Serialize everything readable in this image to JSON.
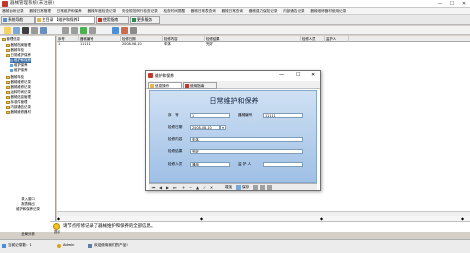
{
  "window": {
    "title": "器械管理系统(未注册)",
    "min": "—",
    "max": "☐",
    "close": "✕"
  },
  "menu": [
    "器械台帐记录",
    "器械日常管理",
    "日常维护和保养",
    "器械年度检查记录",
    "安全规范例行检查记录",
    "检查时间提醒",
    "器械日常表查询",
    "器械日常查询",
    "器械强力保险记录",
    "内部通告记录",
    "器械维修器材使用记录"
  ],
  "tabs": [
    {
      "label": "系统导航"
    },
    {
      "label": "主目录 【维护和保养】"
    },
    {
      "label": "使用指南"
    },
    {
      "label": "更多服务"
    }
  ],
  "sidebar": {
    "items": [
      {
        "label": "管理信息",
        "type": "folder"
      },
      {
        "label": "器械档案管理",
        "type": "folder"
      },
      {
        "label": "器械年检",
        "type": "folder"
      },
      {
        "label": "日常维护保养",
        "type": "folder"
      },
      {
        "label": "维护和保养",
        "type": "leaf",
        "selected": true
      },
      {
        "label": "维护保养",
        "type": "leaf"
      },
      {
        "label": "维护保养",
        "type": "leaf"
      },
      {
        "label": "器械年检",
        "type": "folder"
      },
      {
        "label": "器械维修记录",
        "type": "folder"
      },
      {
        "label": "器械维修记录",
        "type": "folder"
      },
      {
        "label": "运转时间记录",
        "type": "folder"
      },
      {
        "label": "器械信息管理",
        "type": "folder"
      },
      {
        "label": "标准件管理",
        "type": "folder"
      },
      {
        "label": "内部通告记录",
        "type": "folder"
      },
      {
        "label": "器械维修器材",
        "type": "folder"
      }
    ],
    "bottom": [
      "录入窗口",
      "报表输出",
      "维护和保养记录"
    ],
    "footer": "全局分析"
  },
  "grid": {
    "columns": [
      "序号",
      "器械编号",
      "检修日期",
      "检修内容",
      "检修结果",
      "检修人员",
      "监护人"
    ],
    "rows": [
      [
        "1",
        "11111",
        "2008-08-10",
        "车体",
        "完好",
        "",
        ""
      ]
    ]
  },
  "tip": "请节点所修记录了器械维护和保养的全部信息。",
  "tip_label": "提示",
  "status": {
    "left": "当前记录数：1",
    "user": "Admin",
    "msg": "欢迎使用我们的产品!"
  },
  "dialog": {
    "title": "维护和保养",
    "tabs": [
      "信息操作",
      "使用指南"
    ],
    "form_title": "日常维护和保养",
    "fields": {
      "seq_label": "序　号",
      "seq_value": "1",
      "equip_label": "器械编号",
      "equip_value": "11111",
      "date_label": "检修日期",
      "date_value": "2008-08-10",
      "content_label": "检修内容",
      "content_value": "车体",
      "result_label": "检修结果",
      "result_value": "完好",
      "person_label": "检修人员",
      "person_value": "通用",
      "guard_label": "监 护 人",
      "guard_value": ""
    },
    "nav": {
      "add": "增加",
      "save": "保存"
    }
  },
  "colors": {
    "accent": "#3a6ea5",
    "form_bg": "#b8d0ee"
  }
}
